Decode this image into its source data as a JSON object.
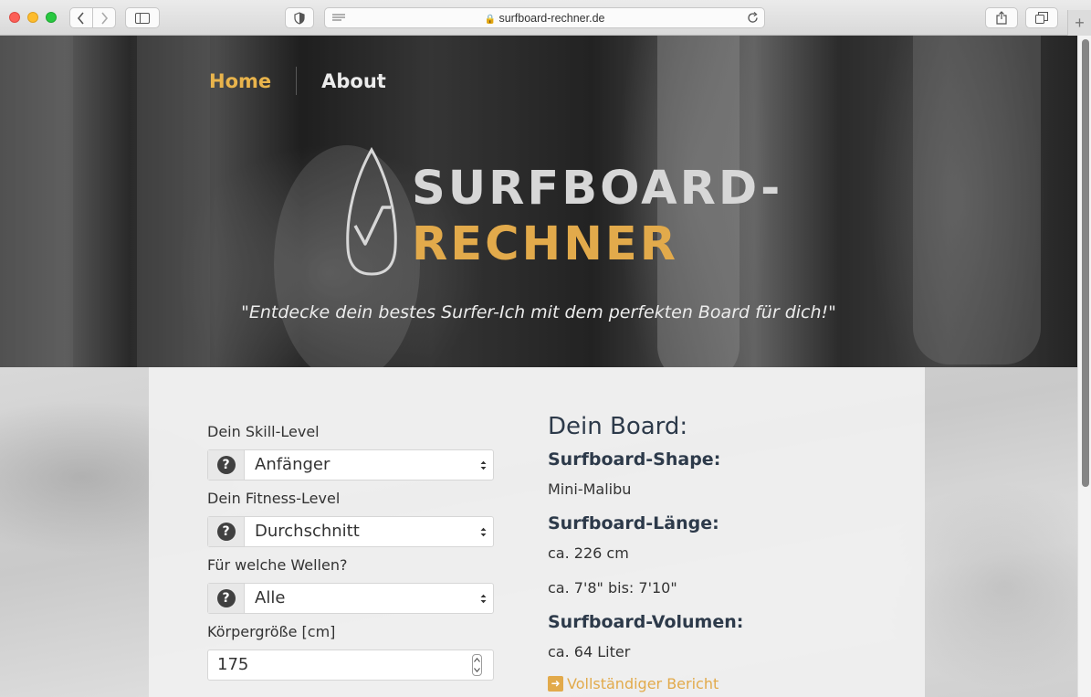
{
  "browser": {
    "url": "surfboard-rechner.de"
  },
  "nav": {
    "home": "Home",
    "about": "About"
  },
  "hero": {
    "logo_line1": "SURFBOARD-",
    "logo_line2": "RECHNER",
    "tagline": "\"Entdecke dein bestes Surfer-Ich mit dem perfekten Board für dich!\""
  },
  "form": {
    "skill_label": "Dein Skill-Level",
    "skill_value": "Anfänger",
    "fitness_label": "Dein Fitness-Level",
    "fitness_value": "Durchschnitt",
    "waves_label": "Für welche Wellen?",
    "waves_value": "Alle",
    "height_label": "Körpergröße [cm]",
    "height_value": "175"
  },
  "result": {
    "title": "Dein Board:",
    "shape_label": "Surfboard-Shape:",
    "shape_value": "Mini-Malibu",
    "length_label": "Surfboard-Länge:",
    "length_cm": "ca. 226 cm",
    "length_ft": "ca. 7'8\" bis: 7'10\"",
    "volume_label": "Surfboard-Volumen:",
    "volume_value": "ca. 64 Liter",
    "report_link": "Vollständiger Bericht"
  },
  "colors": {
    "accent": "#e2aa4b",
    "heading": "#2d3a4a"
  }
}
